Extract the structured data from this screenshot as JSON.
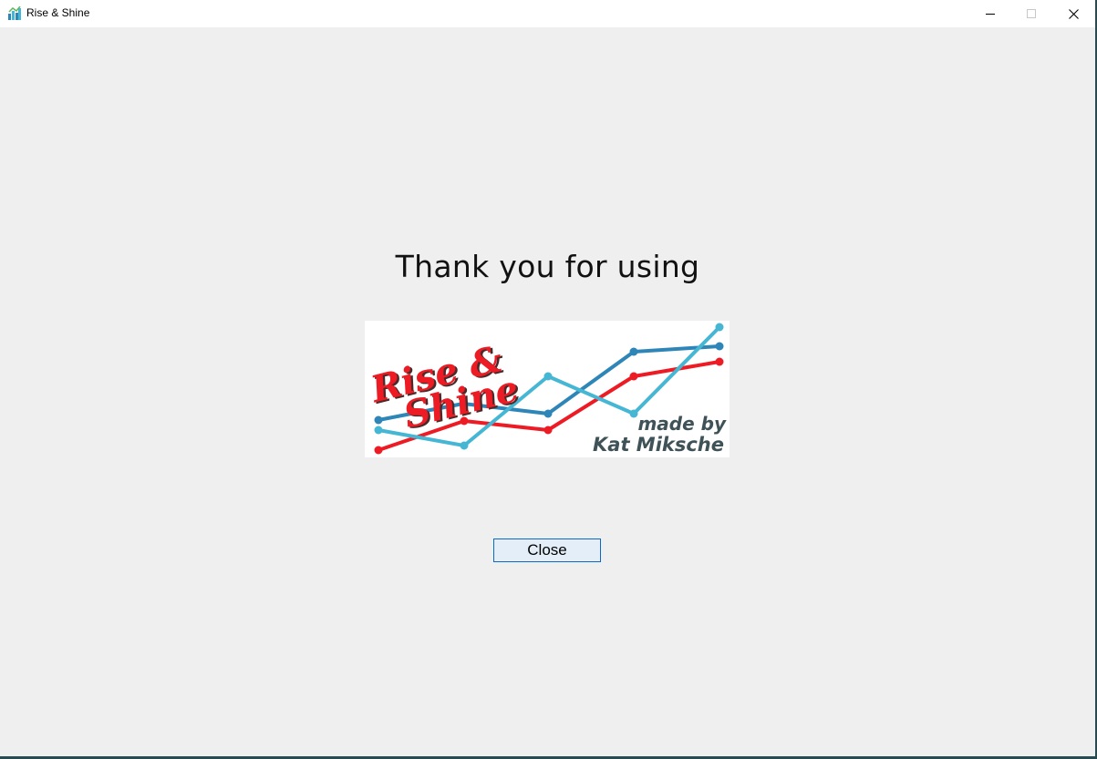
{
  "window": {
    "title": "Rise & Shine",
    "app_icon": "bar-chart-icon",
    "controls": {
      "minimize_icon": "minimize-icon",
      "maximize_icon": "maximize-icon",
      "close_icon": "close-icon"
    }
  },
  "main": {
    "heading": "Thank you for using",
    "logo": {
      "title_line1": "Rise &",
      "title_line2": "Shine",
      "credit_line1": "made by",
      "credit_line2": "Kat Miksche",
      "colors": {
        "red": "#ed1c24",
        "dark_blue": "#2e86b8",
        "light_blue": "#45b6d3",
        "credit_text": "#3f5257",
        "title_shadow": "#4a2a2a"
      }
    },
    "close_button_label": "Close"
  },
  "colors": {
    "background": "#efefef",
    "titlebar": "#ffffff",
    "button_border": "#0a68c6",
    "button_fill": "#e3eef9",
    "window_border": "#2a4a52"
  }
}
